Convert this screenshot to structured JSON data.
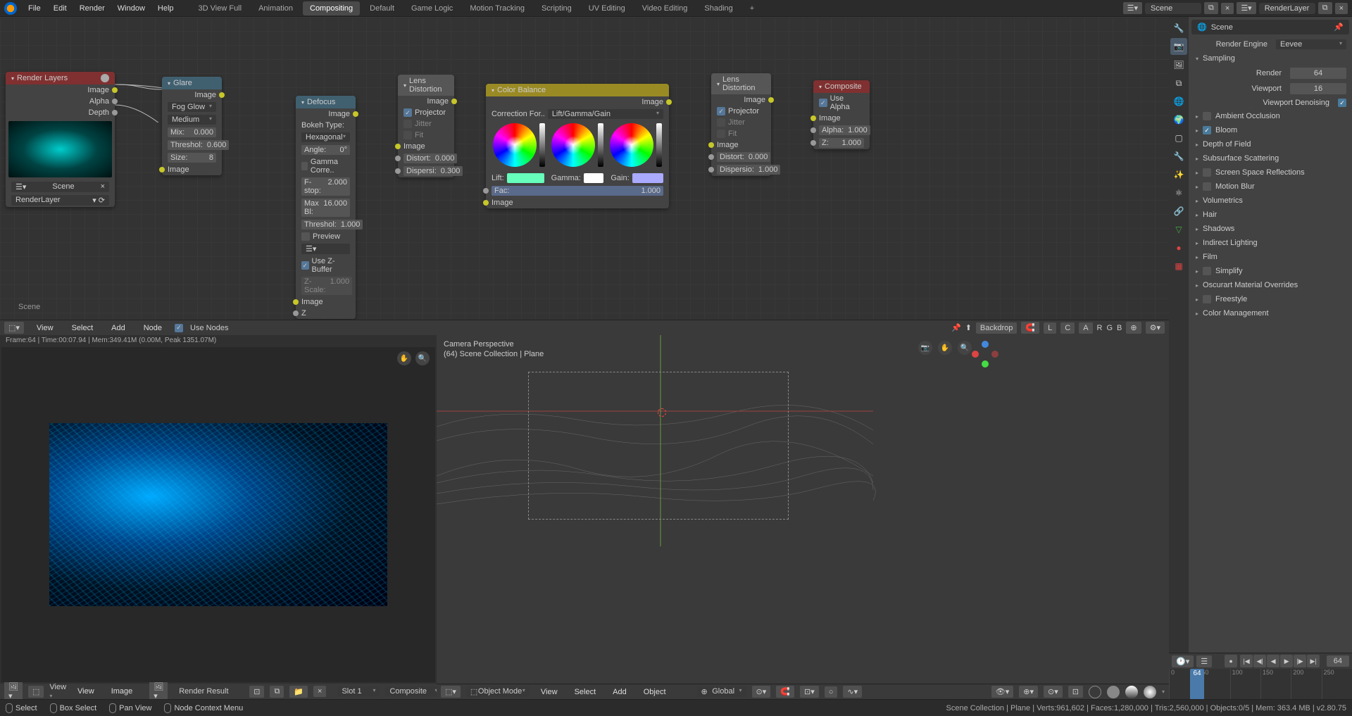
{
  "topmenu": [
    "File",
    "Edit",
    "Render",
    "Window",
    "Help"
  ],
  "workspaces": [
    "3D View Full",
    "Animation",
    "Compositing",
    "Default",
    "Game Logic",
    "Motion Tracking",
    "Scripting",
    "UV Editing",
    "Video Editing",
    "Shading"
  ],
  "active_workspace": "Compositing",
  "scene_name": "Scene",
  "layer_name": "RenderLayer",
  "nodes": {
    "render_layers": {
      "title": "Render Layers",
      "outputs": [
        "Image",
        "Alpha",
        "Depth"
      ],
      "scene": "Scene",
      "layer": "RenderLayer"
    },
    "glare": {
      "title": "Glare",
      "out": "Image",
      "type": "Fog Glow",
      "quality": "Medium",
      "mix_l": "Mix:",
      "mix_v": "0.000",
      "thresh_l": "Threshol:",
      "thresh_v": "0.600",
      "size_l": "Size:",
      "size_v": "8",
      "in": "Image"
    },
    "defocus": {
      "title": "Defocus",
      "out": "Image",
      "bokeh_l": "Bokeh Type:",
      "bokeh": "Hexagonal",
      "angle_l": "Angle:",
      "angle_v": "0°",
      "gamma": "Gamma Corre..",
      "fstop_l": "F-stop:",
      "fstop_v": "2.000",
      "maxbl_l": "Max Bl:",
      "maxbl_v": "16.000",
      "thresh_l": "Threshol:",
      "thresh_v": "1.000",
      "preview": "Preview",
      "usez": "Use Z-Buffer",
      "zscale_l": "Z-Scale:",
      "zscale_v": "1.000",
      "in_image": "Image",
      "in_z": "Z"
    },
    "lens1": {
      "title": "Lens Distortion",
      "out": "Image",
      "projector": "Projector",
      "jitter": "Jitter",
      "fit": "Fit",
      "in_image": "Image",
      "distort_l": "Distort:",
      "distort_v": "0.000",
      "dispersi_l": "Dispersi:",
      "dispersi_v": "0.300"
    },
    "color_balance": {
      "title": "Color Balance",
      "out": "Image",
      "correction_l": "Correction For..",
      "correction_v": "Lift/Gamma/Gain",
      "lift": "Lift:",
      "gamma": "Gamma:",
      "gain": "Gain:",
      "fac_l": "Fac:",
      "fac_v": "1.000",
      "in_image": "Image"
    },
    "lens2": {
      "title": "Lens Distortion",
      "out": "Image",
      "projector": "Projector",
      "jitter": "Jitter",
      "fit": "Fit",
      "in_image": "Image",
      "distort_l": "Distort:",
      "distort_v": "0.000",
      "dispersi_l": "Dispersio:",
      "dispersi_v": "1.000"
    },
    "composite": {
      "title": "Composite",
      "use_alpha": "Use Alpha",
      "in_image": "Image",
      "alpha_l": "Alpha:",
      "alpha_v": "1.000",
      "z_l": "Z:",
      "z_v": "1.000"
    }
  },
  "node_editor_label": "Scene",
  "ne_toolbar": {
    "view": "View",
    "select": "Select",
    "add": "Add",
    "node": "Node",
    "use_nodes": "Use Nodes",
    "backdrop": "Backdrop",
    "channels": [
      "L",
      "C",
      "A",
      "R",
      "G",
      "B"
    ]
  },
  "img_editor": {
    "stats": "Frame:64 | Time:00:07.94 | Mem:349.41M (0.00M, Peak 1351.07M)",
    "view": "View",
    "view2": "View",
    "image": "Image",
    "result": "Render Result",
    "slot": "Slot 1",
    "pass": "Composite"
  },
  "viewport": {
    "cam": "Camera Perspective",
    "path": "(64) Scene Collection | Plane",
    "mode": "Object Mode",
    "view": "View",
    "select": "Select",
    "add": "Add",
    "object": "Object",
    "orient": "Global"
  },
  "properties": {
    "header": "Scene",
    "engine_l": "Render Engine",
    "engine_v": "Eevee",
    "sampling": "Sampling",
    "render_l": "Render",
    "render_v": "64",
    "viewport_l": "Viewport",
    "viewport_v": "16",
    "denoise": "Viewport Denoising",
    "panels": [
      "Ambient Occlusion",
      "Bloom",
      "Depth of Field",
      "Subsurface Scattering",
      "Screen Space Reflections",
      "Motion Blur",
      "Volumetrics",
      "Hair",
      "Shadows",
      "Indirect Lighting",
      "Film",
      "Simplify",
      "Oscurart Material Overrides",
      "Freestyle",
      "Color Management"
    ],
    "panel_checks": {
      "Ambient Occlusion": false,
      "Bloom": true,
      "Screen Space Reflections": false,
      "Motion Blur": false,
      "Simplify": false,
      "Freestyle": false
    }
  },
  "timeline": {
    "frame": "64",
    "ticks": [
      "0",
      "50",
      "100",
      "150",
      "200",
      "250"
    ]
  },
  "statusbar": {
    "select": "Select",
    "box": "Box Select",
    "pan": "Pan View",
    "context": "Node Context Menu",
    "right": "Scene Collection | Plane | Verts:961,602 | Faces:1,280,000 | Tris:2,560,000 | Objects:0/5 | Mem: 363.4 MB | v2.80.75"
  }
}
